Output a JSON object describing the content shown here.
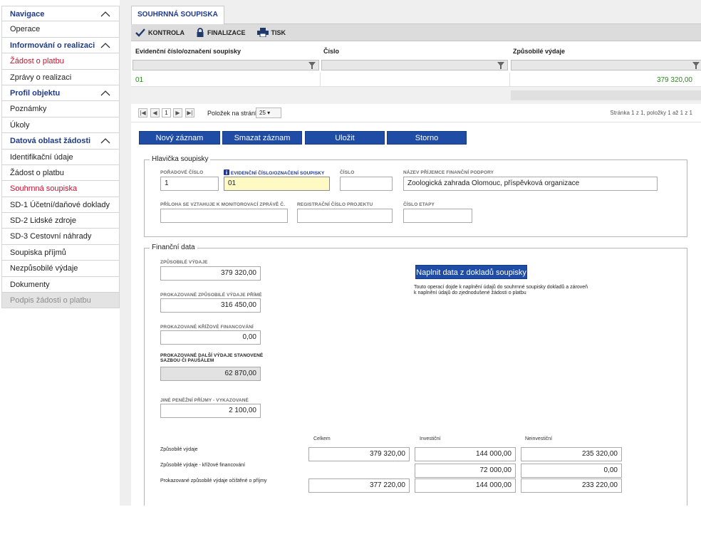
{
  "sidebar": {
    "items": [
      {
        "label": "Navigace",
        "kind": "head"
      },
      {
        "label": "Operace",
        "kind": "item"
      },
      {
        "label": "Informování o realizaci",
        "kind": "head"
      },
      {
        "label": "Žádost o platbu",
        "kind": "red"
      },
      {
        "label": "Zprávy o realizaci",
        "kind": "item"
      },
      {
        "label": "Profil objektu",
        "kind": "head"
      },
      {
        "label": "Poznámky",
        "kind": "item"
      },
      {
        "label": "Úkoly",
        "kind": "item"
      },
      {
        "label": "Datová oblast žádosti",
        "kind": "head"
      },
      {
        "label": "Identifikační údaje",
        "kind": "item"
      },
      {
        "label": "Žádost o platbu",
        "kind": "item"
      },
      {
        "label": "Souhrnná soupiska",
        "kind": "red"
      },
      {
        "label": "SD-1 Účetní/daňové doklady",
        "kind": "item"
      },
      {
        "label": "SD-2 Lidské zdroje",
        "kind": "item"
      },
      {
        "label": "SD-3 Cestovní náhrady",
        "kind": "item"
      },
      {
        "label": "Soupiska příjmů",
        "kind": "item"
      },
      {
        "label": "Nezpůsobilé výdaje",
        "kind": "item"
      },
      {
        "label": "Dokumenty",
        "kind": "item"
      },
      {
        "label": "Podpis žádosti o platbu",
        "kind": "disabled"
      }
    ]
  },
  "tab": {
    "label": "SOUHRNNÁ SOUPISKA"
  },
  "toolbar": {
    "kontrola": "KONTROLA",
    "finalizace": "FINALIZACE",
    "tisk": "TISK"
  },
  "grid": {
    "columns": [
      "Evidenční číslo/označení soupisky",
      "Číslo",
      "Způsobilé výdaje"
    ],
    "rows": [
      {
        "evidencni": "01",
        "cislo": "",
        "zpusobile": "379 320,00"
      }
    ]
  },
  "pager": {
    "page": "1",
    "per_page_label": "Položek na stránku",
    "per_page": "25",
    "info": "Stránka 1 z 1, položky 1 až 1 z 1"
  },
  "actions": {
    "new": "Nový záznam",
    "delete": "Smazat záznam",
    "save": "Uložit",
    "cancel": "Storno"
  },
  "header_section": {
    "legend": "Hlavička soupisky",
    "poradove_label": "POŘADOVÉ ČÍSLO",
    "poradove": "1",
    "evidencni_label": "EVIDENČNÍ ČÍSLO/OZNAČENÍ SOUPISKY",
    "evidencni": "01",
    "cislo_label": "ČÍSLO",
    "cislo": "",
    "prijemce_label": "NÁZEV PŘÍJEMCE FINANČNÍ PODPORY",
    "prijemce": "Zoologická zahrada Olomouc,  příspěvková organizace",
    "priloha_label": "PŘÍLOHA SE VZTAHUJE K MONITOROVACÍ ZPRÁVĚ Č.",
    "priloha": "",
    "registracni_label": "REGISTRAČNÍ ČÍSLO PROJEKTU",
    "registracni": "",
    "etapa_label": "ČÍSLO ETAPY",
    "etapa": ""
  },
  "financial": {
    "legend": "Finanční data",
    "zpusobile_label": "ZPŮSOBILÉ VÝDAJE",
    "zpusobile": "379 320,00",
    "prime_label": "PROKAZOVANÉ ZPŮSOBILÉ VÝDAJE PŘÍMÉ",
    "prime": "316 450,00",
    "krizove_label": "PROKAZOVANÉ KŘÍŽOVÉ FINANCOVÁNÍ",
    "krizove": "0,00",
    "dalsi_label_1": "PROKAZOVANÉ DALŠÍ VÝDAJE STANOVENÉ",
    "dalsi_label_2": "SAZBOU ČI PAUŠÁLEM",
    "dalsi": "62 870,00",
    "jine_label": "JINÉ PENĚŽNÍ PŘÍJMY - VYKAZOVANÉ",
    "jine": "2 100,00",
    "fill_button": "Naplnit data z dokladů soupisky",
    "fill_note_1": "Touto operací dojde k naplnění údajů do souhrnné soupisky dokladů a zároveň",
    "fill_note_2": "k naplnění údajů do zjednodušené žádosti o platbu",
    "summary": {
      "col_headers": [
        "Celkem",
        "Investiční",
        "Neinvestiční"
      ],
      "rows": [
        {
          "label": "Způsobilé výdaje",
          "celkem": "379 320,00",
          "investicni": "144 000,00",
          "neinvesticni": "235 320,00"
        },
        {
          "label": "Způsobilé výdaje - křížové financování",
          "celkem": "",
          "investicni": "72 000,00",
          "neinvesticni": "0,00"
        },
        {
          "label": "Prokazované způsobilé výdaje očištěné o příjmy",
          "celkem": "377 220,00",
          "investicni": "144 000,00",
          "neinvesticni": "233 220,00"
        }
      ]
    }
  },
  "colors": {
    "brand_blue": "#1f4da6",
    "nav_head": "#1f3a8a",
    "active_red": "#c8102e",
    "value_green": "#2b8a1d",
    "highlight_yellow": "#fff9c4"
  }
}
